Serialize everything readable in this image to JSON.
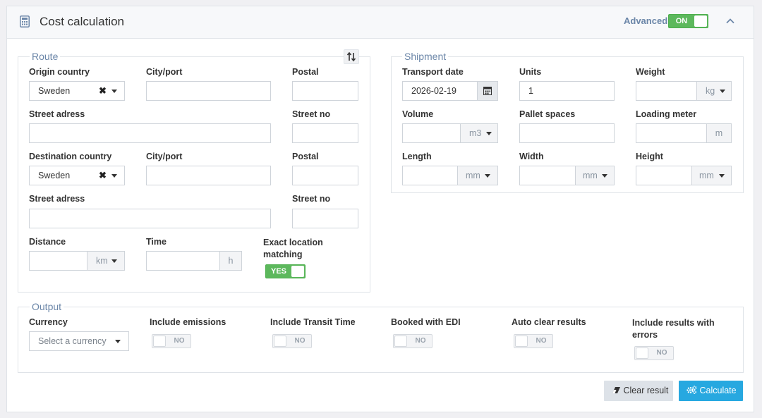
{
  "header": {
    "title": "Cost calculation",
    "advanced_label": "Advanced",
    "advanced_toggle": "ON"
  },
  "route": {
    "legend": "Route",
    "origin_country_label": "Origin country",
    "origin_country_value": "Sweden",
    "origin_city_label": "City/port",
    "origin_postal_label": "Postal",
    "origin_street_label": "Street adress",
    "origin_street_no_label": "Street no",
    "dest_country_label": "Destination country",
    "dest_country_value": "Sweden",
    "dest_city_label": "City/port",
    "dest_postal_label": "Postal",
    "dest_street_label": "Street adress",
    "dest_street_no_label": "Street no",
    "distance_label": "Distance",
    "distance_unit": "km",
    "time_label": "Time",
    "time_unit": "h",
    "exact_match_label": "Exact location matching",
    "exact_match_toggle": "YES"
  },
  "shipment": {
    "legend": "Shipment",
    "transport_date_label": "Transport date",
    "transport_date_value": "2026-02-19",
    "units_label": "Units",
    "units_value": "1",
    "weight_label": "Weight",
    "weight_unit": "kg",
    "volume_label": "Volume",
    "volume_unit": "m3",
    "pallet_label": "Pallet spaces",
    "loading_label": "Loading meter",
    "loading_unit": "m",
    "length_label": "Length",
    "length_unit": "mm",
    "width_label": "Width",
    "width_unit": "mm",
    "height_label": "Height",
    "height_unit": "mm"
  },
  "output": {
    "legend": "Output",
    "currency_label": "Currency",
    "currency_placeholder": "Select a currency",
    "emissions_label": "Include emissions",
    "transit_label": "Include Transit Time",
    "edi_label": "Booked with EDI",
    "autoclear_label": "Auto clear results",
    "errors_label": "Include results with errors",
    "toggle_off_label": "NO"
  },
  "actions": {
    "clear_label": "Clear result",
    "calculate_label": "Calculate"
  },
  "colors": {
    "accent": "#27a8e0",
    "toggle_on": "#5cb85c",
    "legend": "#6b86a8"
  }
}
